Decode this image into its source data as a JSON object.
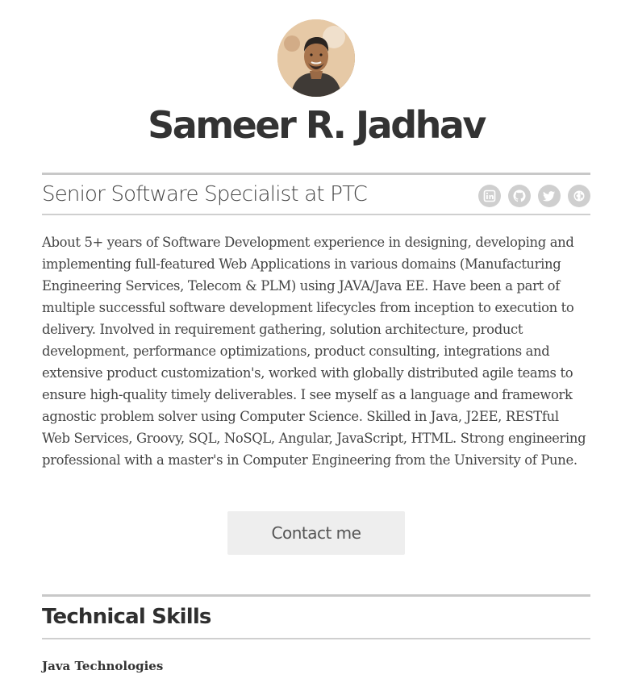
{
  "profile": {
    "name": "Sameer R. Jadhav",
    "title": "Senior Software Specialist at PTC",
    "summary": "About 5+ years of Software Development experience in designing, developing and implementing full-featured Web Applications in various domains (Manufacturing Engineering Services, Telecom & PLM) using JAVA/Java EE. Have been a part of multiple successful software development lifecycles from inception to execution to delivery. Involved in requirement gathering, solution architecture, product development, performance optimizations, product consulting, integrations and extensive product customization's, worked with globally distributed agile teams to ensure high-quality timely deliverables. I see myself as a language and framework agnostic problem solver using Computer Science. Skilled in Java, J2EE, RESTful Web Services, Groovy, SQL, NoSQL, Angular, JavaScript, HTML. Strong engineering professional with a master's in Computer Engineering from the University of Pune."
  },
  "socials": [
    {
      "icon": "linkedin-icon"
    },
    {
      "icon": "github-icon"
    },
    {
      "icon": "twitter-icon"
    },
    {
      "icon": "globe-icon"
    }
  ],
  "contact_button": "Contact me",
  "skills_section": {
    "title": "Technical Skills",
    "subsection": "Java Technologies"
  },
  "colors": {
    "rule": "#c8c8c8",
    "icon_bg": "#cfcfcf",
    "button_bg": "#eeeeee",
    "text": "#3a3a3a"
  }
}
